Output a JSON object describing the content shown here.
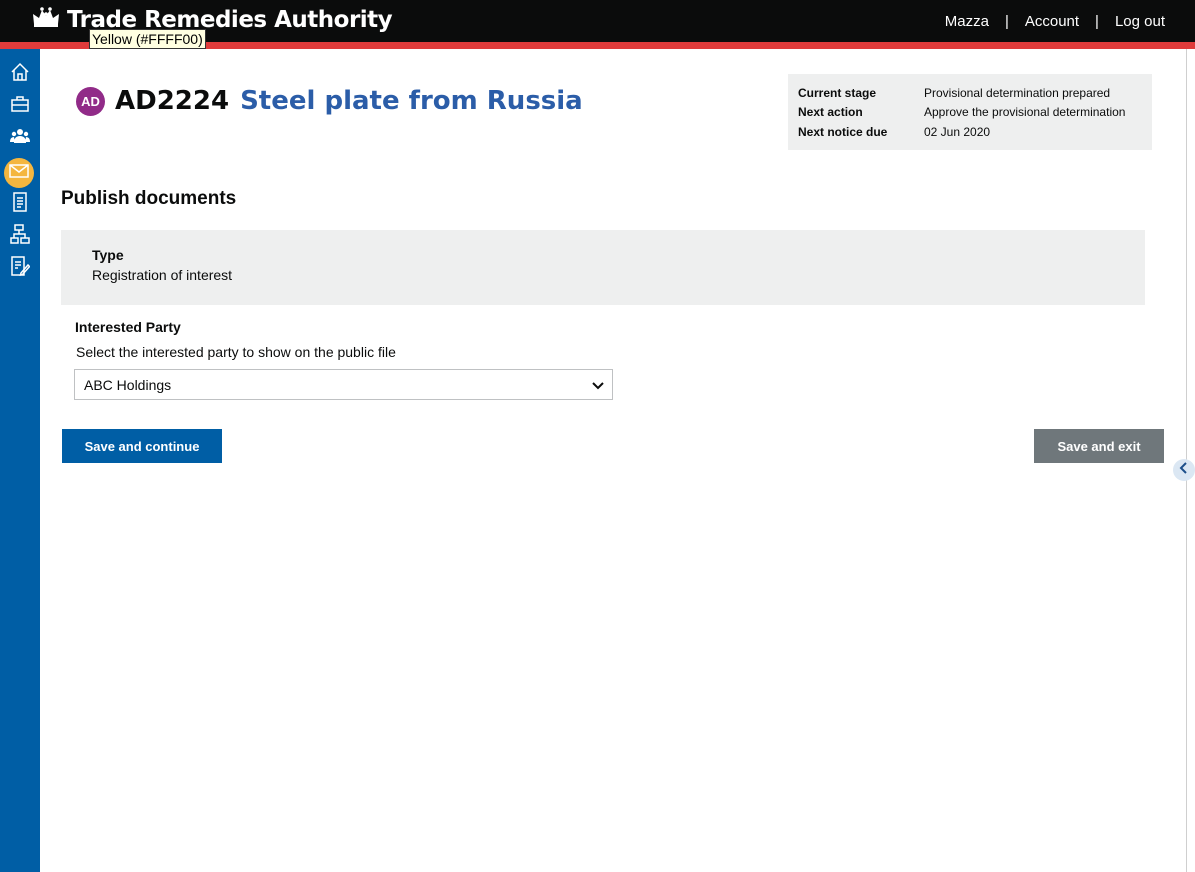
{
  "header": {
    "title": "Trade Remedies Authority",
    "nav": [
      {
        "label": "Mazza"
      },
      {
        "label": "Account"
      },
      {
        "label": "Log out"
      }
    ],
    "separator": "|"
  },
  "tooltip": "Yellow (#FFFF00)",
  "sidebar": {
    "items": [
      {
        "icon": "home-icon"
      },
      {
        "icon": "briefcase-icon"
      },
      {
        "icon": "users-icon"
      },
      {
        "icon": "envelope-icon",
        "active": true
      },
      {
        "icon": "document-icon"
      },
      {
        "icon": "org-chart-icon"
      },
      {
        "icon": "edit-document-icon"
      }
    ]
  },
  "case": {
    "badge": "AD",
    "reference": "AD2224",
    "name": "Steel plate from Russia"
  },
  "stage": {
    "rows": [
      {
        "label": "Current stage",
        "value": "Provisional determination prepared"
      },
      {
        "label": "Next action",
        "value": "Approve the provisional determination"
      },
      {
        "label": "Next notice due",
        "value": "02 Jun 2020"
      }
    ]
  },
  "page": {
    "title": "Publish documents",
    "type_label": "Type",
    "type_value": "Registration of interest",
    "interested_party_label": "Interested Party",
    "interested_party_hint": "Select the interested party to show on the public file",
    "interested_party_selected": "ABC Holdings",
    "save_continue": "Save and continue",
    "save_exit": "Save and exit"
  },
  "colors": {
    "header_bg": "#0b0c0c",
    "header_stripe": "#e03b3b",
    "sidebar_bg": "#005ea5",
    "sidebar_active": "#f4b63f",
    "case_badge": "#912b88",
    "case_name": "#2b5da8",
    "primary_button": "#005ea5",
    "secondary_button": "#6f777b"
  }
}
